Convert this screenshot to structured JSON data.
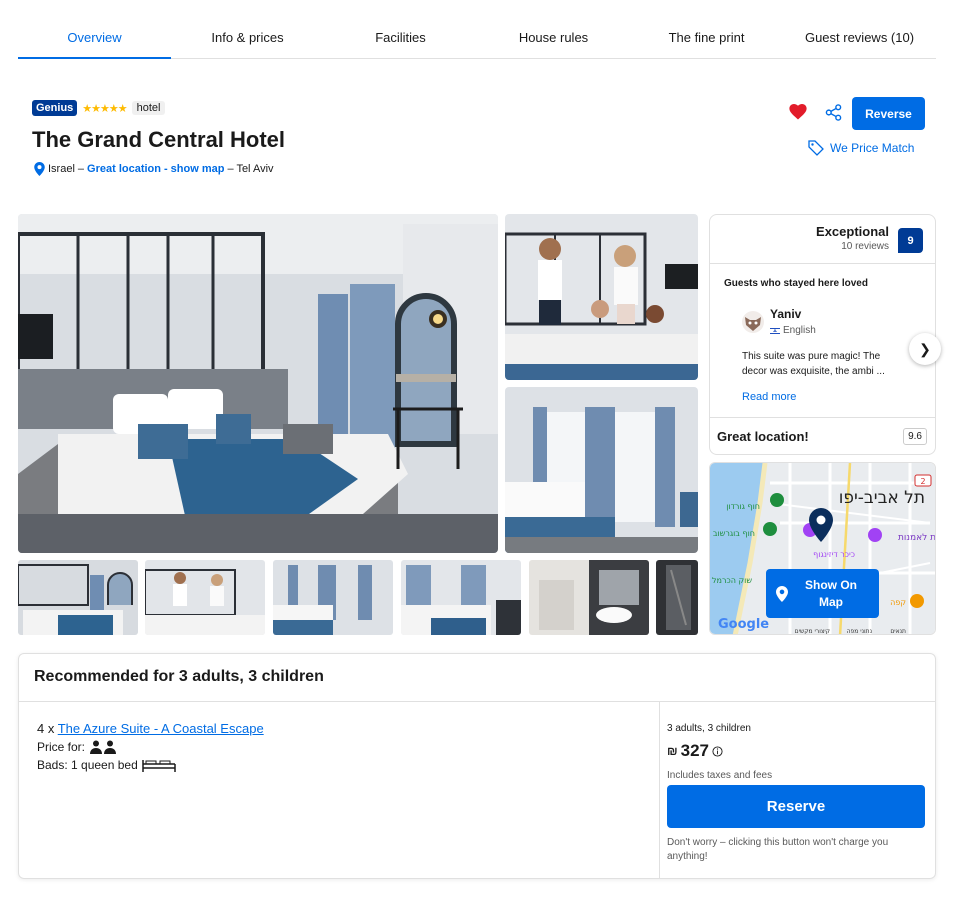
{
  "tabs": [
    "Overview",
    "Info & prices",
    "Facilities",
    "House rules",
    "The fine print",
    "Guest reviews (10)"
  ],
  "header": {
    "genius": "Genius",
    "stars": "★★★★★",
    "type": "hotel",
    "title": "The Grand Central Hotel",
    "country": "Israel",
    "dash1": " –",
    "great_location": "Great location",
    "sep": " - ",
    "show_map": "show map",
    "city": "– Tel Aviv",
    "reverse": "Reverse",
    "price_match": "We Price Match"
  },
  "reviews": {
    "score_word": "Exceptional",
    "count": "10 reviews",
    "score": "9",
    "loved": "Guests who stayed here loved",
    "name": "Yaniv",
    "language": "English",
    "text": "This suite was pure magic! The decor was exquisite, the ambi ...",
    "read_more": "Read more",
    "location_label": "Great location!",
    "location_score": "9.6"
  },
  "map": {
    "city_he": "תל אביב-יפו",
    "show_on_map": "Show On Map",
    "google": "Google",
    "footer": [
      "קיצורי מקשים",
      "נתוני מפה",
      "תנאים"
    ],
    "label_gordon": "חוף גורדון",
    "label_bograshov": "חוף בוגרשוב",
    "label_dizengoff": "כיכר דיזינגוף",
    "label_carmel": "שוק הכרמל",
    "label_art": "ת לאמנות",
    "label_cafe": "קפה",
    "road": "2"
  },
  "recommended": {
    "title": "Recommended for 3 adults, 3 children",
    "qty": "4 x ",
    "room_name": "The Azure Suite - A Coastal Escape",
    "price_for": "Price for:",
    "beds": "Bads: 1 queen bed",
    "occupancy": "3 adults, 3 children",
    "currency": "₪",
    "price": "327",
    "taxes": "Includes taxes and fees",
    "reserve": "Reserve",
    "note": "Don't worry – clicking this button won't charge you anything!"
  }
}
